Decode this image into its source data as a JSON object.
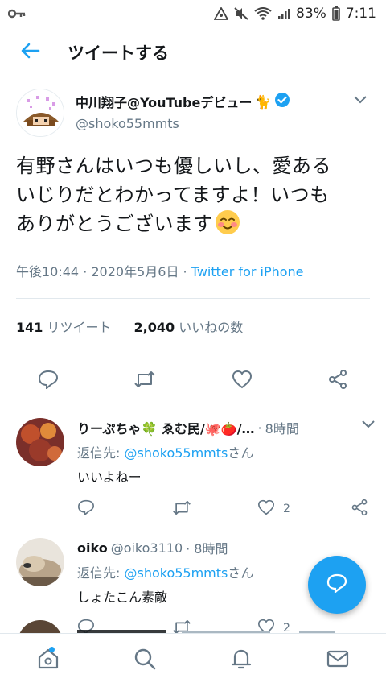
{
  "statusbar": {
    "battery": "83%",
    "time": "7:11"
  },
  "header": {
    "title": "ツイートする"
  },
  "tweet": {
    "author_name": "中川翔子@YouTubeデビュー",
    "author_emoji": "🐈",
    "handle": "@shoko55mmts",
    "text_line1": "有野さんはいつも優しいし、愛ある",
    "text_line2": "いじりだとわかってますよ！いつも",
    "text_line3": "ありがとうございます",
    "time": "午後10:44 · 2020年5月6日 ·",
    "source": "Twitter for iPhone",
    "retweet_count": "141",
    "retweet_label": "リツイート",
    "like_count": "2,040",
    "like_label": "いいねの数"
  },
  "replies": [
    {
      "name": "りーぷちゃ🍀 ゑむ民/🐙🍅/…",
      "handle": "",
      "time": "8時間",
      "reply_to_prefix": "返信先: ",
      "reply_to_handle": "@shoko55mmts",
      "reply_to_suffix": "さん",
      "text": "いいよねー",
      "like_count": "2"
    },
    {
      "name": "oiko",
      "handle": "@oiko3110",
      "time": "· 8時間",
      "reply_to_prefix": "返信先: ",
      "reply_to_handle": "@shoko55mmts",
      "reply_to_suffix": "さん",
      "text": "しょたこん素敵",
      "like_count": "2"
    }
  ],
  "colors": {
    "accent": "#1da1f2",
    "muted": "#657786",
    "text": "#14171a",
    "divider": "#e1e8ed"
  },
  "icons": [
    "key-icon",
    "data-saver-icon",
    "mute-icon",
    "wifi-icon",
    "signal-icon",
    "battery-icon",
    "back-arrow-icon",
    "verified-icon",
    "chevron-down-icon",
    "reply-icon",
    "retweet-icon",
    "like-icon",
    "share-icon",
    "compose-icon",
    "home-icon",
    "search-icon",
    "notifications-icon",
    "messages-icon"
  ]
}
